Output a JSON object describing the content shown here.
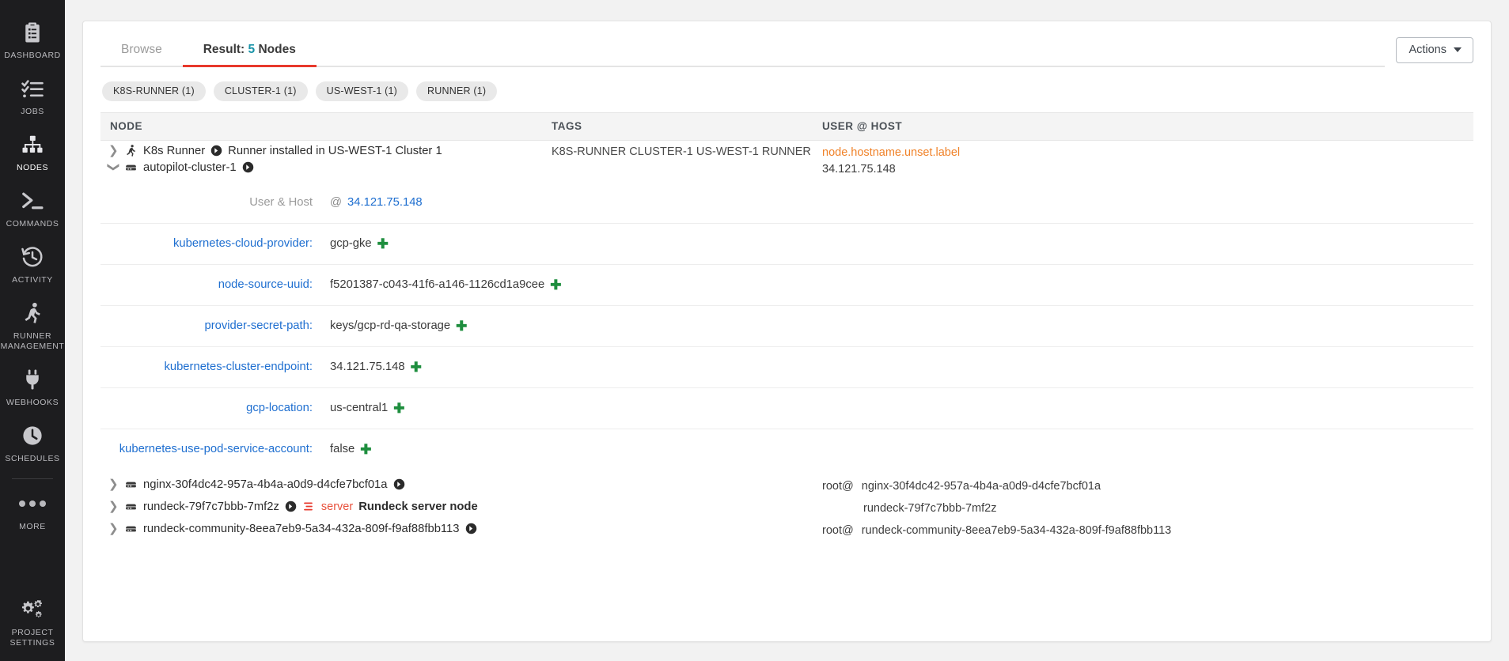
{
  "sidebar": {
    "items": [
      {
        "label": "DASHBOARD",
        "icon": "clipboard-list-icon",
        "active": false
      },
      {
        "label": "JOBS",
        "icon": "checklist-icon",
        "active": false
      },
      {
        "label": "NODES",
        "icon": "nodes-hierarchy-icon",
        "active": true
      },
      {
        "label": "COMMANDS",
        "icon": "terminal-prompt-icon",
        "active": false
      },
      {
        "label": "ACTIVITY",
        "icon": "history-clock-icon",
        "active": false
      },
      {
        "label": "RUNNER MANAGEMENT",
        "icon": "runner-person-icon",
        "active": false
      },
      {
        "label": "WEBHOOKS",
        "icon": "plug-icon",
        "active": false
      },
      {
        "label": "SCHEDULES",
        "icon": "clock-icon",
        "active": false
      },
      {
        "label": "MORE",
        "icon": "ellipsis-icon",
        "active": false
      },
      {
        "label": "PROJECT SETTINGS",
        "icon": "gears-icon",
        "active": false
      }
    ]
  },
  "header": {
    "tabs": [
      {
        "label": "Browse",
        "active": false,
        "count": ""
      },
      {
        "label": "Result:",
        "active": true,
        "count": "5",
        "suffix": "Nodes"
      }
    ],
    "actions_label": "Actions"
  },
  "filters": {
    "chips": [
      "K8S-RUNNER (1)",
      "CLUSTER-1 (1)",
      "US-WEST-1 (1)",
      "RUNNER (1)"
    ]
  },
  "table": {
    "columns": {
      "node": "NODE",
      "tags": "TAGS",
      "user_host": "USER @ HOST"
    },
    "rows": [
      {
        "name": "K8s Runner",
        "description": "Runner installed in US-WEST-1 Cluster 1",
        "icon": "runner-person-icon",
        "chevron": "collapsed",
        "tags": "K8S-RUNNER CLUSTER-1 US-WEST-1 RUNNER",
        "user": "",
        "host": "node.hostname.unset.label"
      },
      {
        "name": "autopilot-cluster-1",
        "description": "",
        "icon": "server-icon",
        "chevron": "expanded",
        "tags": "",
        "user": "",
        "host": "34.121.75.148"
      }
    ],
    "bottom_rows": [
      {
        "name": "nginx-30f4dc42-957a-4b4a-a0d9-d4cfe7bcf01a",
        "description": "",
        "icon": "server-icon",
        "chevron": "collapsed",
        "badge": "",
        "user": "root@",
        "host": "nginx-30f4dc42-957a-4b4a-a0d9-d4cfe7bcf01a"
      },
      {
        "name": "rundeck-79f7c7bbb-7mf2z",
        "description": "Rundeck server node",
        "icon": "server-icon",
        "chevron": "collapsed",
        "badge": "server",
        "user": "",
        "host": "rundeck-79f7c7bbb-7mf2z"
      },
      {
        "name": "rundeck-community-8eea7eb9-5a34-432a-809f-f9af88fbb113",
        "description": "",
        "icon": "server-icon",
        "chevron": "collapsed",
        "badge": "",
        "user": "root@",
        "host": "rundeck-community-8eea7eb9-5a34-432a-809f-f9af88fbb113"
      }
    ]
  },
  "detail": {
    "user_host_label": "User & Host",
    "user_host_at": "@",
    "user_host_value": "34.121.75.148",
    "attributes": [
      {
        "key": "kubernetes-cloud-provider:",
        "value": "gcp-gke"
      },
      {
        "key": "node-source-uuid:",
        "value": "f5201387-c043-41f6-a146-1126cd1a9cee"
      },
      {
        "key": "provider-secret-path:",
        "value": "keys/gcp-rd-qa-storage"
      },
      {
        "key": "kubernetes-cluster-endpoint:",
        "value": "34.121.75.148"
      },
      {
        "key": "gcp-location:",
        "value": "us-central1"
      },
      {
        "key": "kubernetes-use-pod-service-account:",
        "value": "false"
      }
    ]
  },
  "colors": {
    "accent_red": "#e8392c",
    "tab_count_teal": "#1993a8",
    "link_blue": "#1f6fd0",
    "plus_green": "#1e8e3e",
    "unset_orange": "#f08229",
    "server_badge_red": "#e8513c",
    "sidebar_bg": "#1d1d1f"
  }
}
